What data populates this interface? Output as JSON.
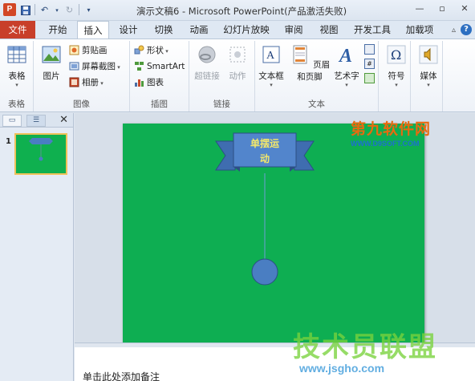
{
  "window": {
    "title": "演示文稿6 - Microsoft PowerPoint(产品激活失败)",
    "app_icon_letter": "P"
  },
  "ribbon_tabs": [
    "文件",
    "开始",
    "插入",
    "设计",
    "切换",
    "动画",
    "幻灯片放映",
    "审阅",
    "视图",
    "开发工具",
    "加载项"
  ],
  "active_tab": "插入",
  "ribbon": {
    "groups": {
      "table": {
        "label": "表格",
        "btn_table": "表格"
      },
      "image": {
        "label": "图像",
        "btn_picture": "图片",
        "btn_clipart": "剪贴画",
        "btn_screenshot": "屏幕截图",
        "btn_album": "相册"
      },
      "illustration": {
        "label": "插图",
        "btn_shapes": "形状",
        "btn_smartart": "SmartArt",
        "btn_chart": "图表"
      },
      "link": {
        "label": "链接",
        "btn_hyperlink": "超链接",
        "btn_action": "动作"
      },
      "text": {
        "label": "文本",
        "btn_textbox": "文本框",
        "btn_header": "页眉和页脚",
        "btn_wordart": "艺术字"
      },
      "symbol": {
        "btn_symbol": "符号"
      },
      "media": {
        "btn_media": "媒体"
      }
    }
  },
  "left_pane": {
    "slide_number": "1"
  },
  "slide": {
    "banner_text_line1": "单摆运",
    "banner_text_line2": "动"
  },
  "notes": {
    "placeholder": "单击此处添加备注"
  },
  "watermarks": {
    "top_big": "第九软件网",
    "top_small": "WWW.D9SOFT.COM",
    "bottom_big": "技术员联盟",
    "bottom_small": "www.jsgho.com"
  },
  "colors": {
    "slide_bg": "#0eae52",
    "banner_fill": "#4a7ec2",
    "banner_text": "#f4e86a",
    "pendulum_bob": "#4a7ec2",
    "file_tab": "#c83f2a"
  }
}
